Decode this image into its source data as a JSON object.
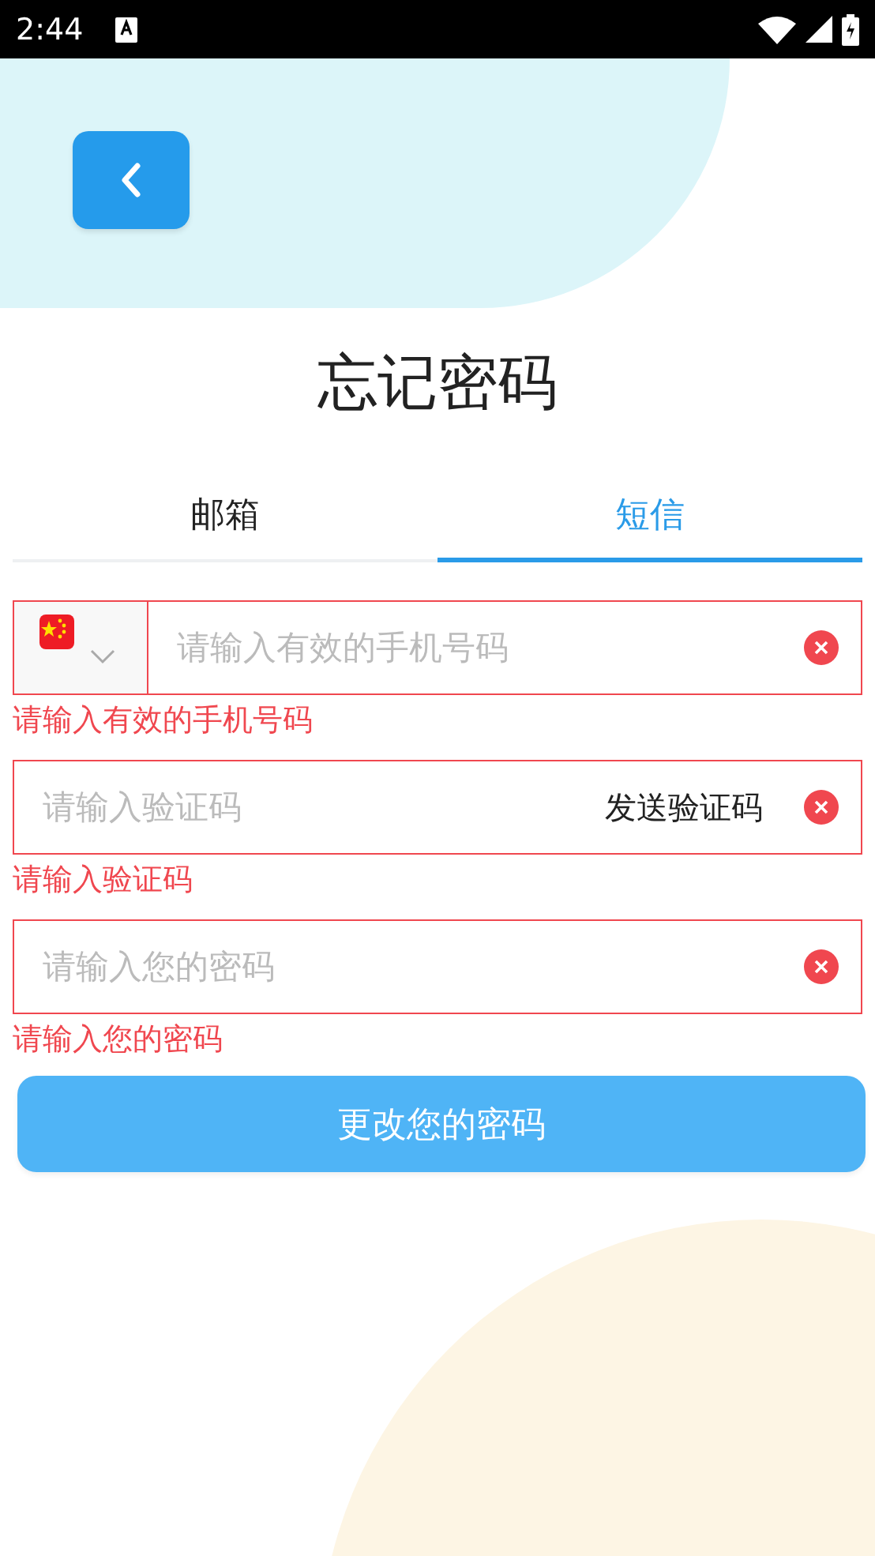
{
  "status_bar": {
    "time": "2:44"
  },
  "title": "忘记密码",
  "tabs": [
    {
      "label": "邮箱",
      "selected": false
    },
    {
      "label": "短信",
      "selected": true
    }
  ],
  "fields": [
    {
      "kind": "phone",
      "placeholder": "请输入有效的手机号码",
      "error": "请输入有效的手机号码"
    },
    {
      "kind": "code",
      "placeholder": "请输入验证码",
      "action": "发送验证码",
      "error": "请输入验证码"
    },
    {
      "kind": "password",
      "placeholder": "请输入您的密码",
      "error": "请输入您的密码"
    }
  ],
  "submit": "更改您的密码"
}
